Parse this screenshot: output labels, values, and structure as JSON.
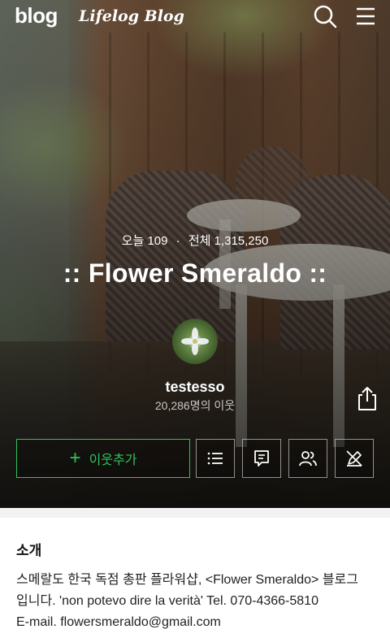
{
  "header": {
    "logo": "blog",
    "sub_logo": "Lifelog Blog",
    "search_icon": "search-icon",
    "menu_icon": "hamburger-menu-icon"
  },
  "stats": {
    "today_label": "오늘",
    "today_value": "109",
    "total_label": "전체",
    "total_value": "1,315,250"
  },
  "blog": {
    "title": ":: Flower Smeraldo ::",
    "nickname": "testesso",
    "neighbors": "20,286명의 이웃"
  },
  "actions": {
    "add_neighbor_label": "이웃추가",
    "icons": [
      "list-icon",
      "message-icon",
      "people-icon",
      "no-edit-icon"
    ]
  },
  "intro": {
    "title": "소개",
    "lines": [
      "스메랄도 한국 독점 총판 플라워샵, <Flower Smeraldo> 블로그",
      "입니다. 'non potevo dire la verità' Tel. 070-4366-5810",
      "E-mail. flowersmeraldo@gmail.com"
    ]
  },
  "colors": {
    "accent_green": "#2ec35c",
    "white": "#ffffff"
  }
}
